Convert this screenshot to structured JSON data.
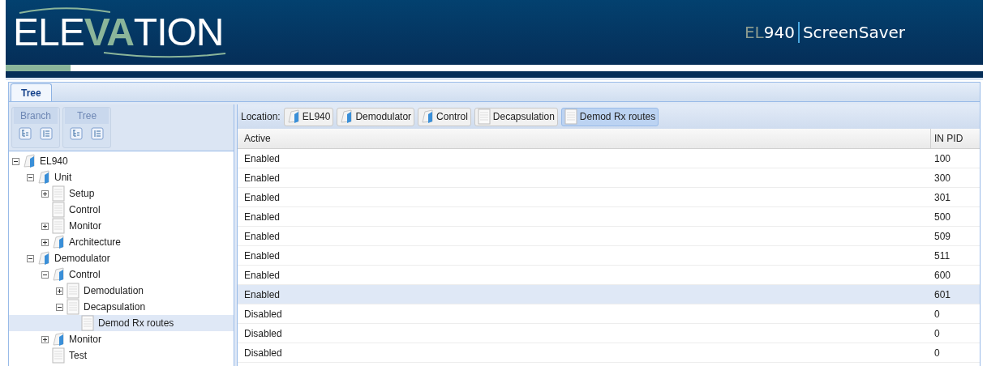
{
  "header": {
    "logo": [
      {
        "text": "ELE",
        "accent": false
      },
      {
        "text": "VA",
        "accent": true
      },
      {
        "text": "TION",
        "accent": false
      }
    ],
    "product": [
      {
        "text": "EL",
        "accent": true
      },
      {
        "text": "940",
        "accent": false
      }
    ],
    "app": "ScreenSaver"
  },
  "tabs": [
    {
      "label": "Tree",
      "selected": true
    }
  ],
  "toolbar": [
    {
      "label": "Branch",
      "buttons": [
        {
          "kind": "expand"
        },
        {
          "kind": "collapse"
        }
      ]
    },
    {
      "label": "Tree",
      "buttons": [
        {
          "kind": "expand"
        },
        {
          "kind": "collapse"
        }
      ]
    }
  ],
  "tree": [
    {
      "label": "EL940",
      "kind": "folder",
      "expanded": true,
      "selected": false,
      "children": [
        {
          "label": "Unit",
          "kind": "folder",
          "expanded": true,
          "selected": false,
          "children": [
            {
              "label": "Setup",
              "kind": "page",
              "expanded": false,
              "selected": false
            },
            {
              "label": "Control",
              "kind": "page",
              "selected": false
            },
            {
              "label": "Monitor",
              "kind": "page",
              "expanded": false,
              "selected": false
            },
            {
              "label": "Architecture",
              "kind": "folder",
              "expanded": false,
              "selected": false
            }
          ]
        },
        {
          "label": "Demodulator",
          "kind": "folder",
          "expanded": true,
          "selected": false,
          "children": [
            {
              "label": "Control",
              "kind": "folder",
              "expanded": true,
              "selected": false,
              "children": [
                {
                  "label": "Demodulation",
                  "kind": "page",
                  "expanded": false,
                  "selected": false
                },
                {
                  "label": "Decapsulation",
                  "kind": "page",
                  "expanded": true,
                  "selected": false,
                  "children": [
                    {
                      "label": "Demod Rx routes",
                      "kind": "page",
                      "selected": true
                    }
                  ]
                }
              ]
            },
            {
              "label": "Monitor",
              "kind": "folder",
              "expanded": false,
              "selected": false
            },
            {
              "label": "Test",
              "kind": "page",
              "selected": false
            }
          ]
        }
      ]
    }
  ],
  "location": {
    "label": "Location:",
    "crumbs": [
      {
        "label": "EL940",
        "kind": "folder",
        "selected": false
      },
      {
        "label": "Demodulator",
        "kind": "folder",
        "selected": false
      },
      {
        "label": "Control",
        "kind": "folder",
        "selected": false
      },
      {
        "label": "Decapsulation",
        "kind": "page",
        "selected": false
      },
      {
        "label": "Demod Rx routes",
        "kind": "page",
        "selected": true
      }
    ]
  },
  "table": {
    "columns": [
      "Active",
      "IN PID"
    ],
    "rows": [
      {
        "cells": [
          "Enabled",
          "100"
        ],
        "selected": false
      },
      {
        "cells": [
          "Enabled",
          "300"
        ],
        "selected": false
      },
      {
        "cells": [
          "Enabled",
          "301"
        ],
        "selected": false
      },
      {
        "cells": [
          "Enabled",
          "500"
        ],
        "selected": false
      },
      {
        "cells": [
          "Enabled",
          "509"
        ],
        "selected": false
      },
      {
        "cells": [
          "Enabled",
          "511"
        ],
        "selected": false
      },
      {
        "cells": [
          "Enabled",
          "600"
        ],
        "selected": false
      },
      {
        "cells": [
          "Enabled",
          "601"
        ],
        "selected": true
      },
      {
        "cells": [
          "Disabled",
          "0"
        ],
        "selected": false
      },
      {
        "cells": [
          "Disabled",
          "0"
        ],
        "selected": false
      },
      {
        "cells": [
          "Disabled",
          "0"
        ],
        "selected": false
      }
    ]
  }
}
